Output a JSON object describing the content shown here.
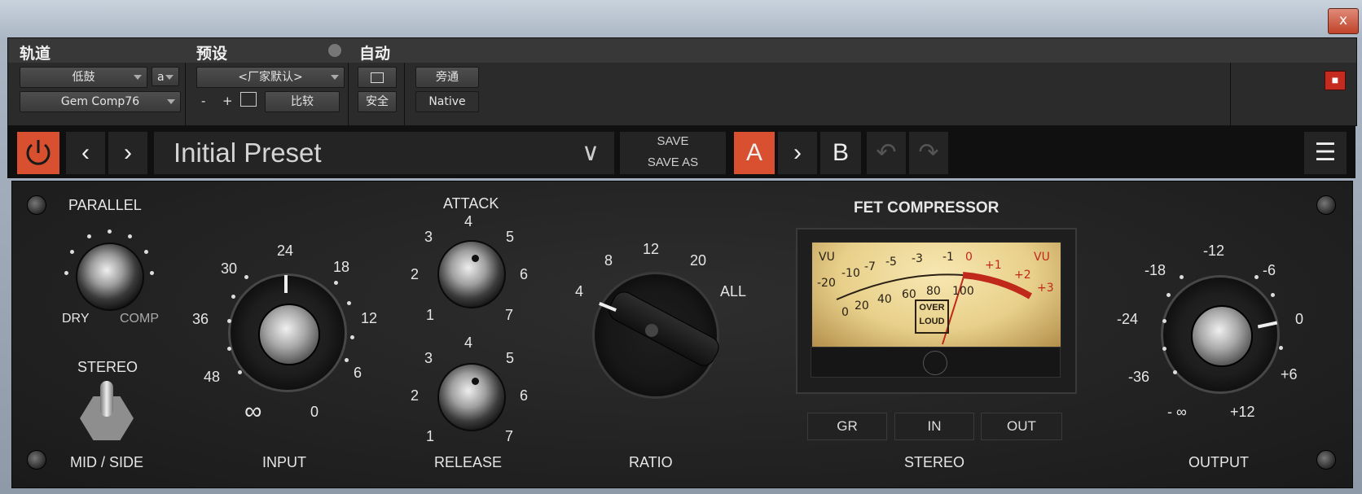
{
  "window": {
    "close_glyph": "x"
  },
  "host": {
    "track": {
      "header": "轨道",
      "name": "低鼓",
      "channel": "a",
      "plugin": "Gem Comp76"
    },
    "preset": {
      "header": "预设",
      "name": "<厂家默认>",
      "minus": "-",
      "plus": "+",
      "compare": "比较"
    },
    "auto": {
      "header": "自动",
      "safe": "安全"
    },
    "bypass": "旁通",
    "native": "Native"
  },
  "toolbar": {
    "preset_name": "Initial Preset",
    "save": "SAVE",
    "save_as": "SAVE AS",
    "a": "A",
    "b": "B"
  },
  "plugin": {
    "parallel": {
      "label": "PARALLEL",
      "dry": "DRY",
      "comp": "COMP"
    },
    "stereo_switch": {
      "top": "STEREO",
      "bottom": "MID / SIDE"
    },
    "input": {
      "label": "INPUT",
      "ticks": [
        "24",
        "18",
        "12",
        "6",
        "0",
        "∞",
        "48",
        "36",
        "30"
      ]
    },
    "attack": {
      "label": "ATTACK",
      "ticks": [
        "4",
        "5",
        "6",
        "7",
        "1",
        "2",
        "3"
      ]
    },
    "release": {
      "label": "RELEASE",
      "ticks": [
        "4",
        "5",
        "6",
        "7",
        "1",
        "2",
        "3"
      ]
    },
    "ratio": {
      "label": "RATIO",
      "ticks": [
        "4",
        "8",
        "12",
        "20",
        "ALL"
      ]
    },
    "meter": {
      "title": "FET COMPRESSOR",
      "vu_left": "VU",
      "vu_right": "VU",
      "scale_top": [
        "-20",
        "-10",
        "-7",
        "-5",
        "-3",
        "-1",
        "0",
        "+1",
        "+2",
        "+3"
      ],
      "scale_bottom": [
        "0",
        "20",
        "40",
        "60",
        "80",
        "100"
      ],
      "badge_1": "OVER",
      "badge_2": "LOUD",
      "modes": [
        "GR",
        "IN",
        "OUT"
      ],
      "mode_label": "STEREO"
    },
    "output": {
      "label": "OUTPUT",
      "ticks": [
        "-12",
        "-6",
        "0",
        "+6",
        "+12",
        "- ∞",
        "-36",
        "-24",
        "-18"
      ]
    }
  },
  "colors": {
    "accent": "#d8502f",
    "vu_red": "#c0281a"
  }
}
